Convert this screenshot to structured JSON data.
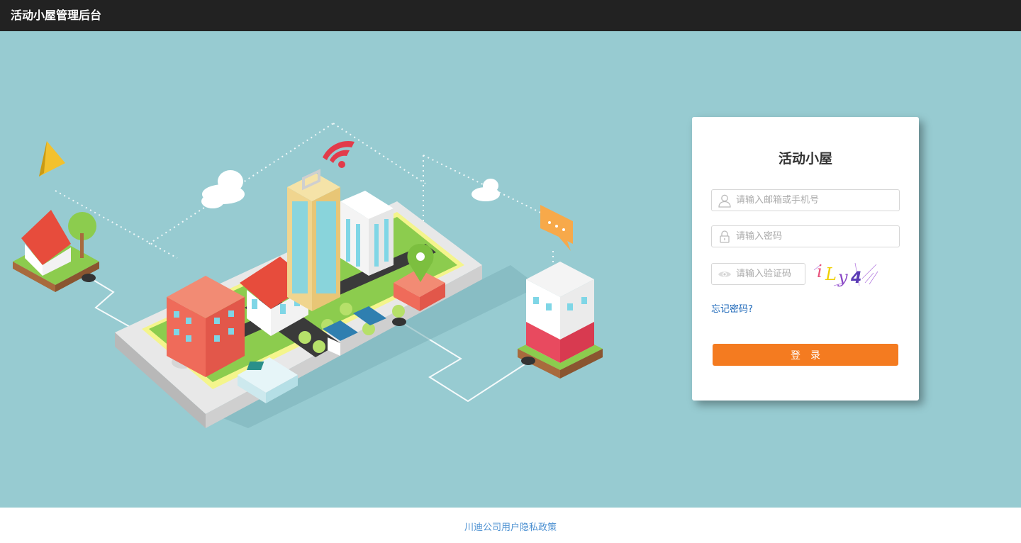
{
  "header": {
    "title": "活动小屋管理后台"
  },
  "login": {
    "title": "活动小屋",
    "email_placeholder": "请输入邮箱或手机号",
    "password_placeholder": "请输入密码",
    "captcha_placeholder": "请输入验证码",
    "captcha_text": "iLy4",
    "forgot_label": "忘记密码?",
    "submit_label": "登录"
  },
  "footer": {
    "privacy_link": "川迪公司用户隐私政策"
  },
  "colors": {
    "topbar": "#222222",
    "background": "#97cbd1",
    "primary_button": "#f47b20",
    "link": "#1a66b8",
    "footer_link": "#4a8fd1"
  },
  "icons": {
    "email": "user-icon",
    "password": "lock-icon",
    "captcha": "eye-icon"
  }
}
